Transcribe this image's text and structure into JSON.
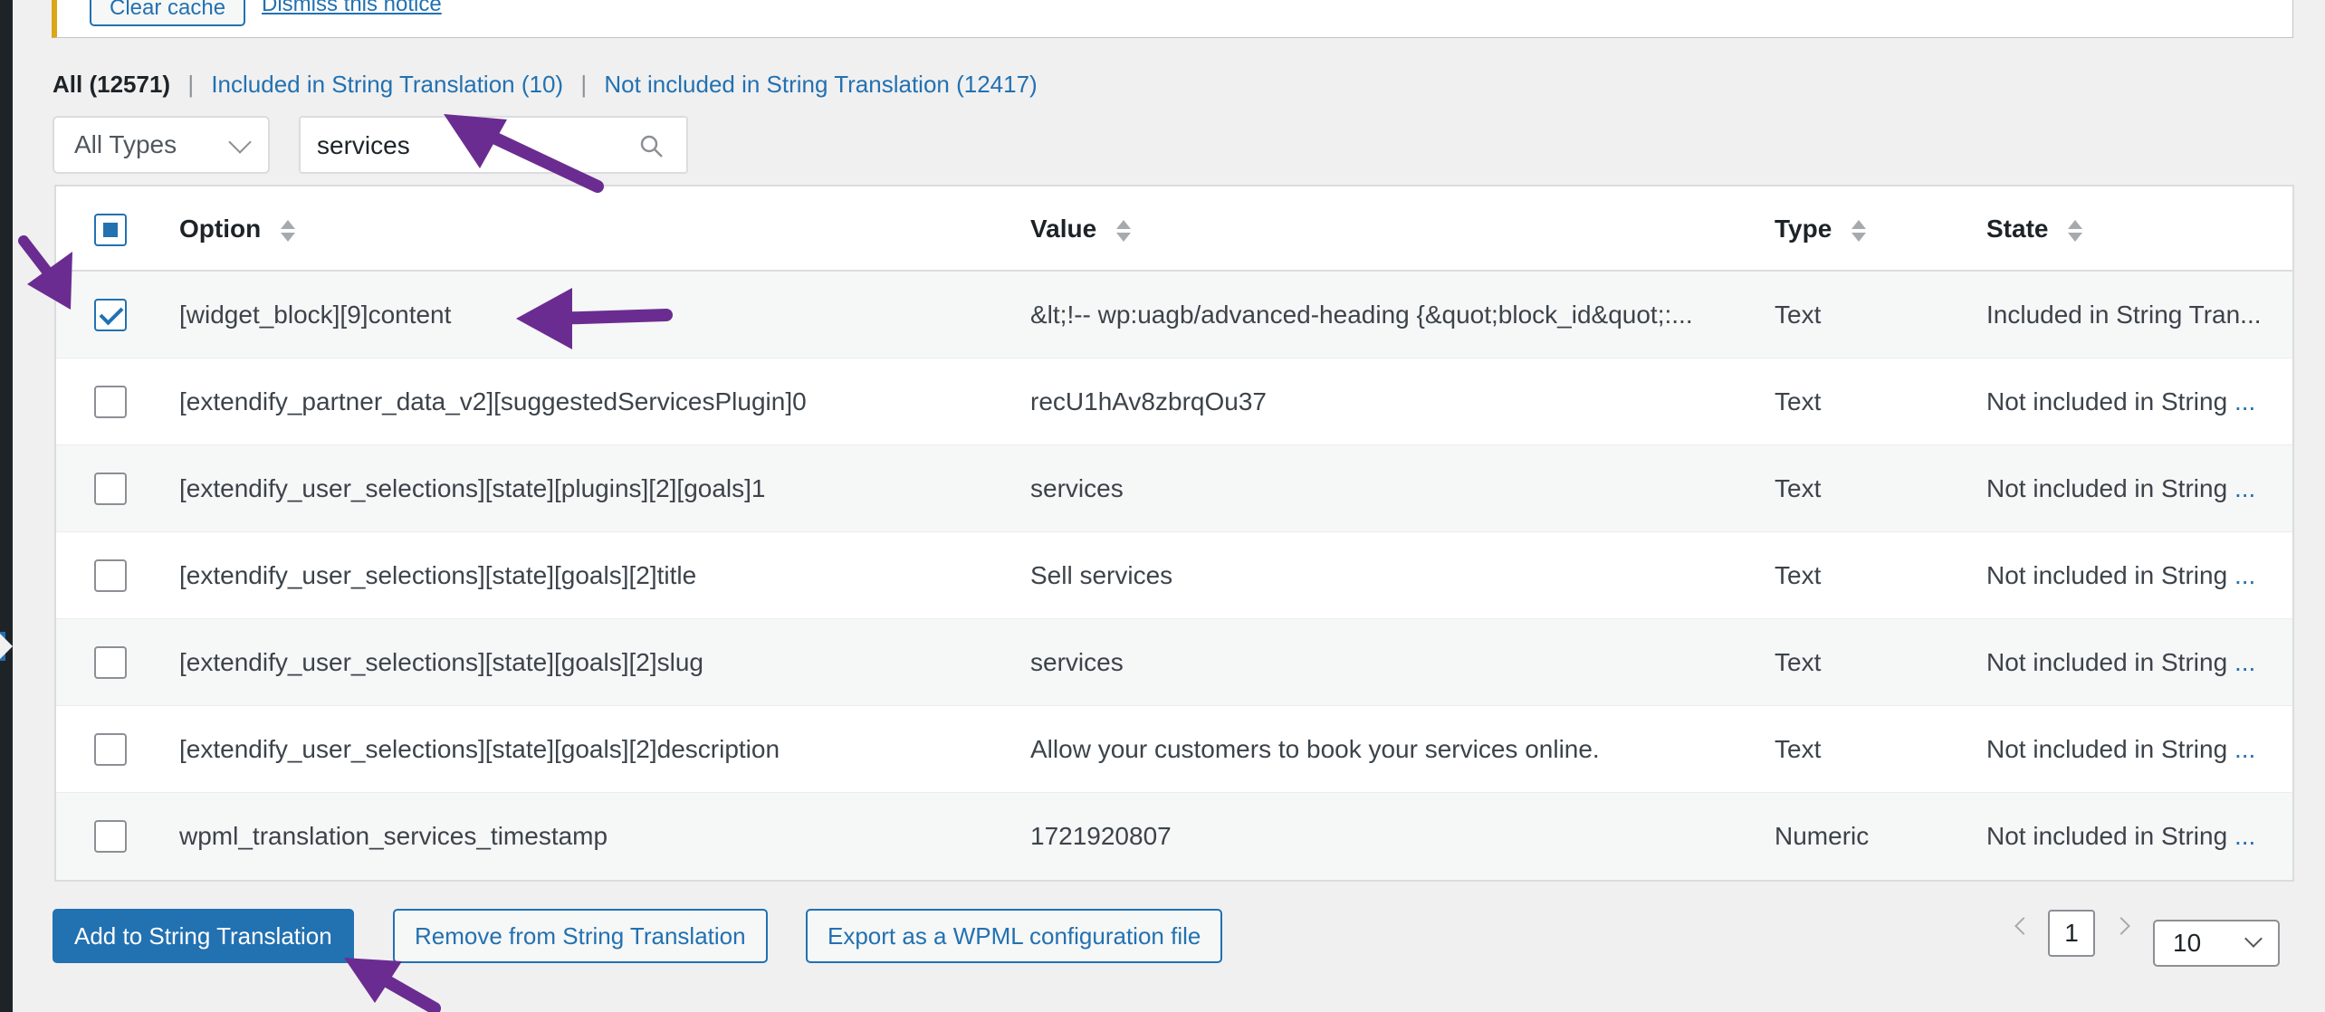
{
  "notice": {
    "button_label": "Clear cache",
    "link_label": "Dismiss this notice"
  },
  "filters": {
    "all": "All (12571)",
    "included": "Included in String Translation (10)",
    "not_included": "Not included in String Translation (12417)",
    "separator": "|"
  },
  "type_select": {
    "value": "All Types"
  },
  "search": {
    "value": "services"
  },
  "table": {
    "headers": {
      "option": "Option",
      "value": "Value",
      "type": "Type",
      "state": "State"
    },
    "rows": [
      {
        "option": "[widget_block][9]content",
        "value": "&lt;!-- wp:uagb/advanced-heading {&quot;block_id&quot;:...",
        "type": "Text",
        "state": "Included in String Tran...",
        "state_more": "",
        "checked": true
      },
      {
        "option": "[extendify_partner_data_v2][suggestedServicesPlugin]0",
        "value": "recU1hAv8zbrqOu37",
        "type": "Text",
        "state": "Not included in String ",
        "state_more": "...",
        "checked": false
      },
      {
        "option": "[extendify_user_selections][state][plugins][2][goals]1",
        "value": "services",
        "type": "Text",
        "state": "Not included in String ",
        "state_more": "...",
        "checked": false
      },
      {
        "option": "[extendify_user_selections][state][goals][2]title",
        "value": "Sell services",
        "type": "Text",
        "state": "Not included in String ",
        "state_more": "...",
        "checked": false
      },
      {
        "option": "[extendify_user_selections][state][goals][2]slug",
        "value": "services",
        "type": "Text",
        "state": "Not included in String ",
        "state_more": "...",
        "checked": false
      },
      {
        "option": "[extendify_user_selections][state][goals][2]description",
        "value": "Allow your customers to book your services online.",
        "type": "Text",
        "state": "Not included in String ",
        "state_more": "...",
        "checked": false
      },
      {
        "option": "wpml_translation_services_timestamp",
        "value": "1721920807",
        "type": "Numeric",
        "state": "Not included in String ",
        "state_more": "...",
        "checked": false
      }
    ]
  },
  "actions": {
    "add": "Add to String Translation",
    "remove": "Remove from String Translation",
    "export": "Export as a WPML configuration file"
  },
  "pagination": {
    "current_page": "1",
    "per_page": "10"
  },
  "colors": {
    "accent": "#2271b1",
    "annotation_arrow": "#6b2c91",
    "notice_border": "#dba617"
  }
}
